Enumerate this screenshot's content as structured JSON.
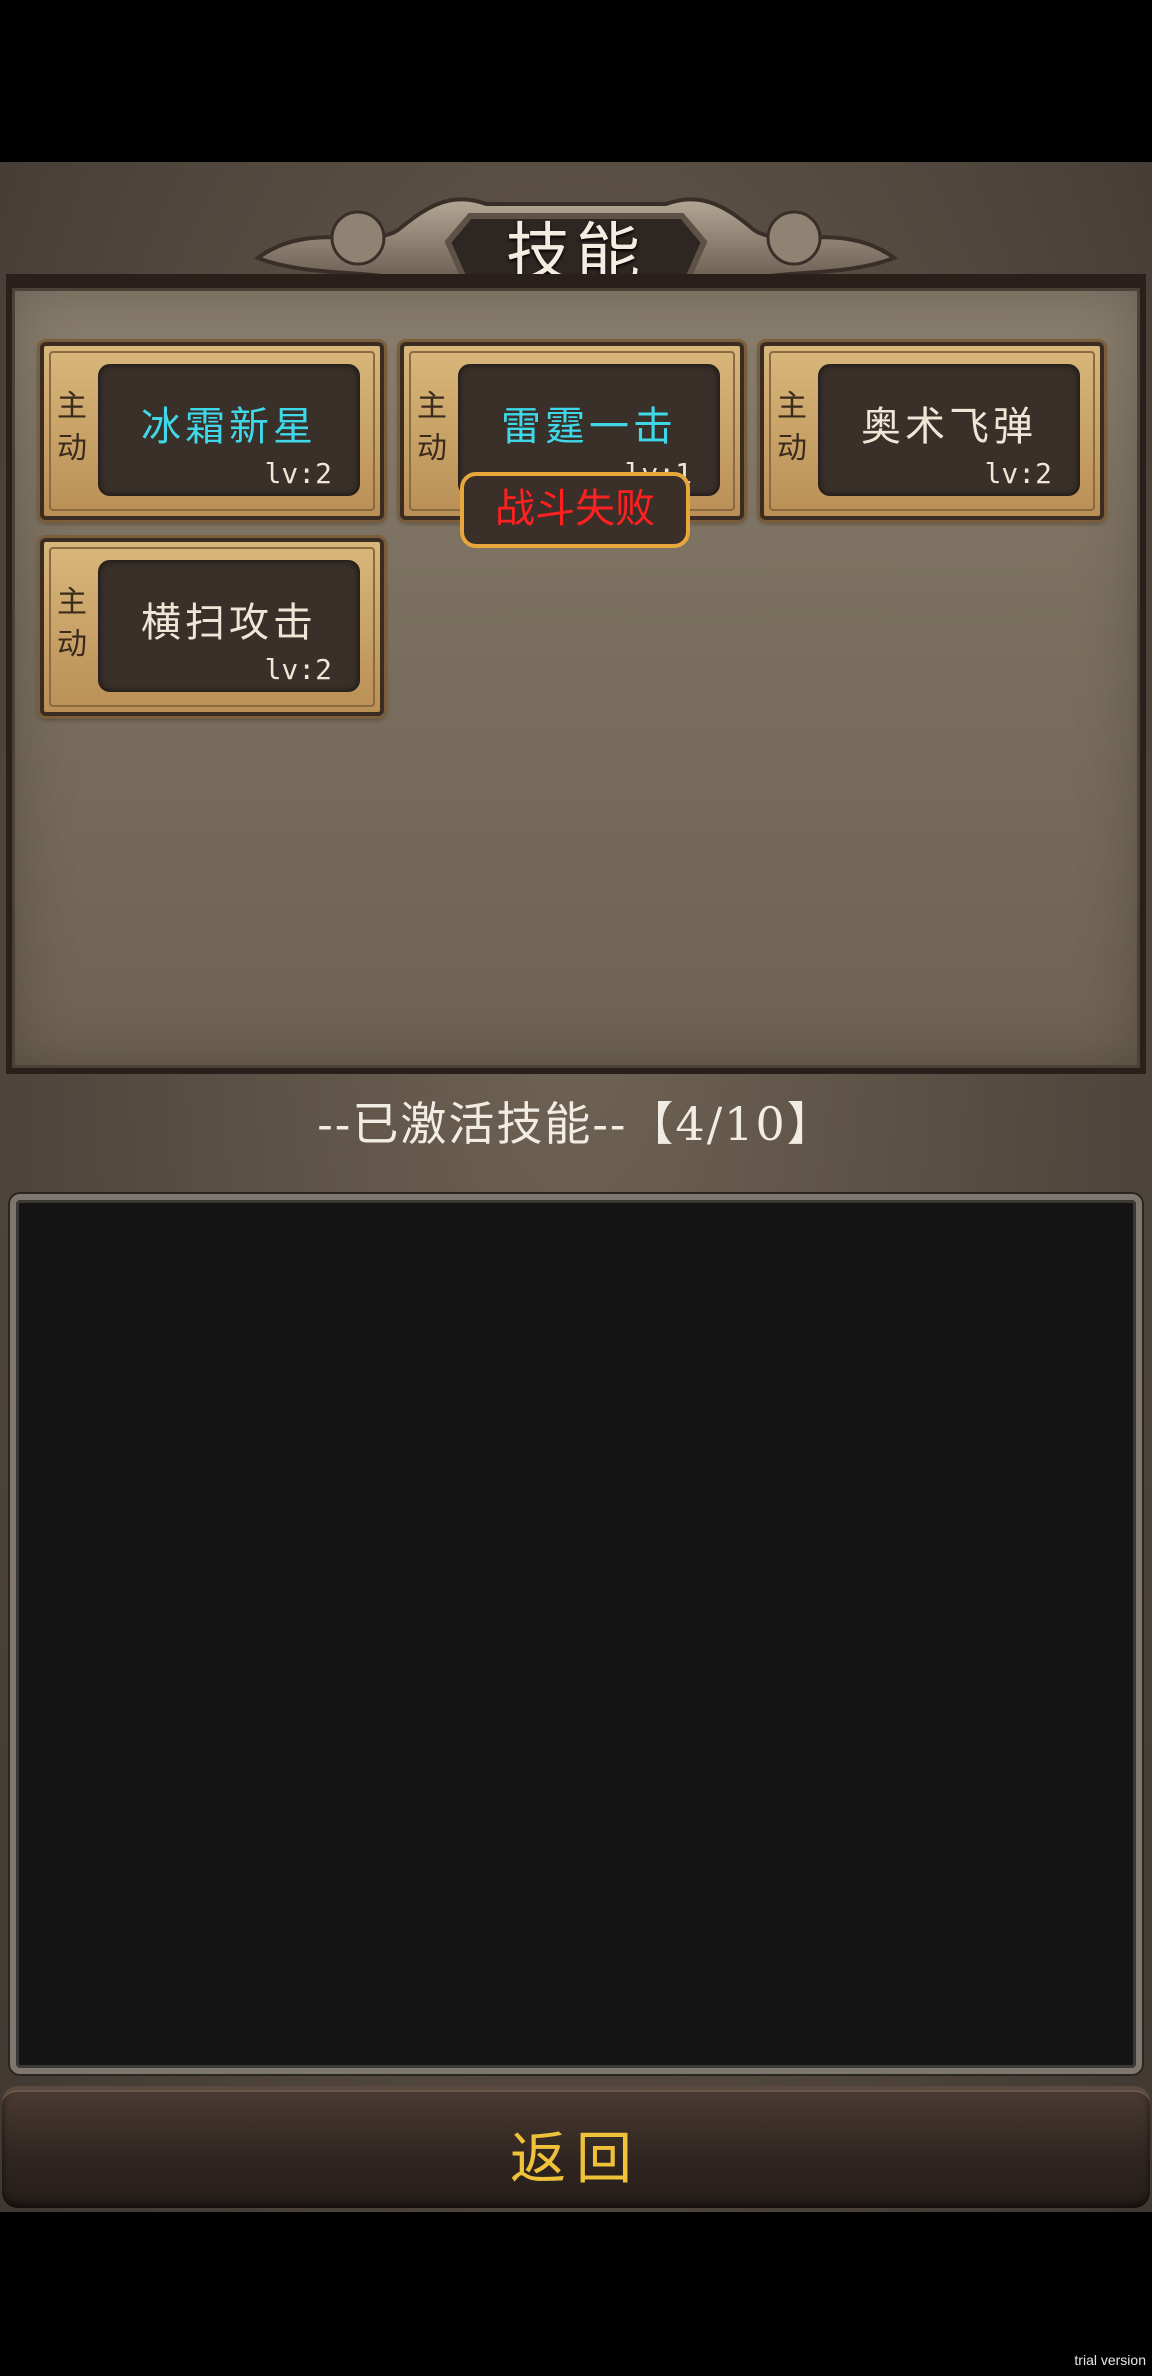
{
  "screen": {
    "title": "技能",
    "skills": [
      {
        "type": "主\n动",
        "name": "冰霜新星",
        "level": "lv:2",
        "name_color": "#3fd8e8"
      },
      {
        "type": "主\n动",
        "name": "雷霆一击",
        "level": "lv:1",
        "name_color": "#3fd8e8"
      },
      {
        "type": "主\n动",
        "name": "奥术飞弹",
        "level": "lv:2",
        "name_color": "#efe6d6"
      },
      {
        "type": "主\n动",
        "name": "横扫攻击",
        "level": "lv:2",
        "name_color": "#efe6d6"
      }
    ],
    "toast": "战斗失败",
    "activated_label": "--已激活技能--【4/10】",
    "back_label": "返回"
  },
  "watermark": "trial version"
}
